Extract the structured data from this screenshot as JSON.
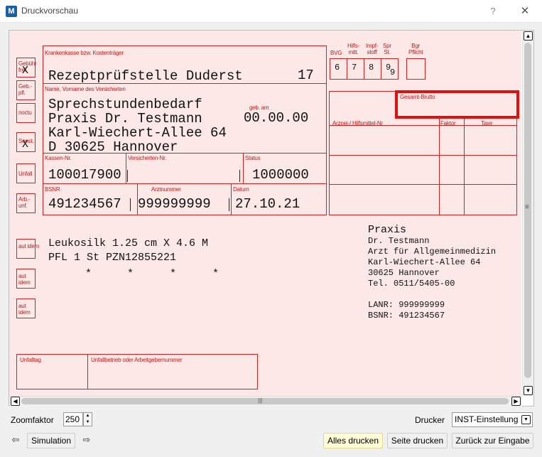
{
  "window": {
    "title": "Druckvorschau",
    "help": "?",
    "close": "✕",
    "app_icon": "M"
  },
  "form": {
    "labels": {
      "krankenkasse": "Krankenkasse bzw. Kostenträger",
      "name": "Name, Vorname des Versicherten",
      "geb": "geb. am",
      "kassen_nr": "Kassen-Nr.",
      "versicherten_nr": "Versicherten-Nr.",
      "status": "Status",
      "bsnr": "BSNR",
      "arztnummer": "Arztnummer",
      "datum": "Datum",
      "bvg": "BVG",
      "hilfs": "Hilfs-\nmitt.",
      "impf": "Impf-\nstoff",
      "spr": "Spr\nSt.",
      "bgr": "Bgr\nPflicht",
      "gesamt_brutto": "Gesamt-Brutto",
      "arznei": "Arznei-/ Hilfsmittel-Nr",
      "faktor": "Faktor",
      "taxe": "Taxe",
      "unfalltag": "Unfalltag",
      "unfallbetrieb": "Unfallbetrieb oder Arbeitgebernummer"
    },
    "side_boxes": [
      {
        "label": "Gebühr\nfrei",
        "mark": "X"
      },
      {
        "label": "Geb.-\npfl.",
        "mark": ""
      },
      {
        "label": "noctu",
        "mark": ""
      },
      {
        "label": "Sonst.",
        "mark": "X"
      },
      {
        "label": "Unfall",
        "mark": ""
      },
      {
        "label": "Arb.-\nunf.",
        "mark": ""
      }
    ],
    "aut_idem": [
      "aut\nidem",
      "aut\nidem",
      "aut\nidem"
    ],
    "kasse": "Rezeptprüfstelle Duderst",
    "kasse_code": "17",
    "patient_lines": [
      "Sprechstundenbedarf",
      "Praxis Dr. Testmann",
      "Karl-Wiechert-Allee 64",
      "D 30625 Hannover"
    ],
    "geb_datum": "00.00.00",
    "kassen_nr": "100017900",
    "status": "1000000",
    "bsnr": "491234567",
    "arztnummer": "999999999",
    "datum": "27.10.21",
    "slot_numbers": [
      "6",
      "7",
      "8",
      "9",
      "9"
    ],
    "rx_line1": "Leukosilk 1.25 cm X 4.6 M",
    "rx_line2": "PFL 1 St PZN12855221",
    "stars": [
      "*",
      "*",
      "*",
      "*"
    ],
    "stamp": {
      "title": "Praxis",
      "lines": [
        "Dr. Testmann",
        "Arzt für Allgemeinmedizin",
        "Karl-Wiechert-Allee 64",
        "30625 Hannover",
        "Tel. 0511/5405-00"
      ],
      "lanr": "LANR: 999999999",
      "bsnr": "BSNR: 491234567"
    }
  },
  "scroll": {
    "up": "▲",
    "down": "▼",
    "left": "◀",
    "right": "▶",
    "grip_v": "≡",
    "grip_h": "|||"
  },
  "controls": {
    "zoom_label": "Zoomfaktor",
    "zoom_value": "250",
    "drucker_label": "Drucker",
    "drucker_value": "INST-Einstellung",
    "prev": "⇦",
    "next": "⇨",
    "simulation": "Simulation",
    "alles_drucken": "Alles drucken",
    "seite_drucken": "Seite drucken",
    "zurueck": "Zurück zur Eingabe"
  }
}
